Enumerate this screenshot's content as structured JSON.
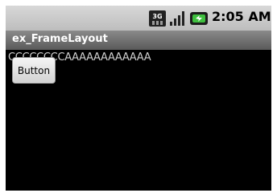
{
  "status_bar": {
    "network_label": "3G",
    "signal_icon": "signal-bars-icon",
    "battery_icon": "battery-charging-icon",
    "time": "2:05 AM"
  },
  "title_bar": {
    "title": "ex_FrameLayout"
  },
  "content": {
    "text": "CCCCCCCCAAAAAAAAAAAA",
    "button_label": "Button"
  },
  "colors": {
    "screen_background": "#000000",
    "title_bar": "#6e6e6e",
    "status_bar": "#c8c8c8",
    "text": "#cfcfcf"
  }
}
